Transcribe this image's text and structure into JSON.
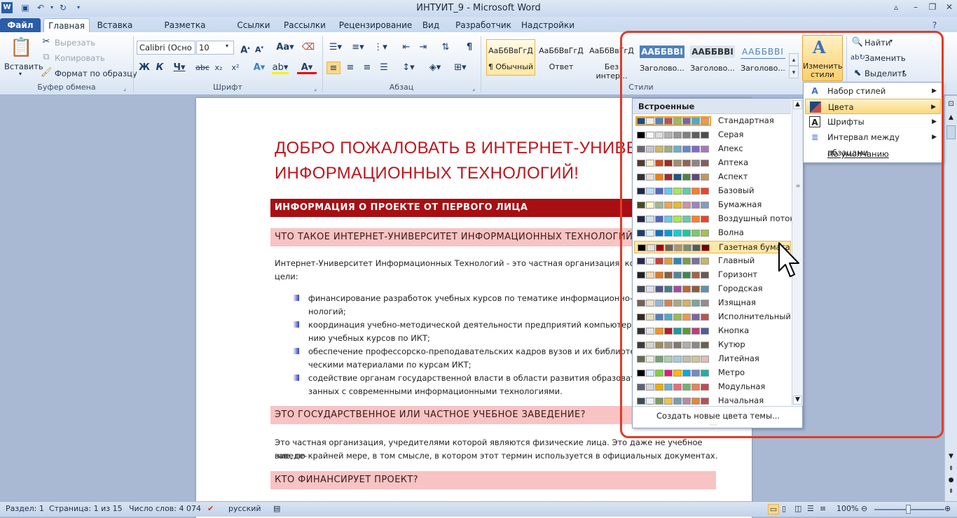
{
  "app": {
    "window_title": "ИНТУИТ_9 - Microsoft Word",
    "quick_access": [
      "word-logo-icon",
      "save-icon",
      "undo-icon",
      "redo-icon",
      "customize-icon"
    ]
  },
  "tabs": [
    {
      "label": "Файл"
    },
    {
      "label": "Главная"
    },
    {
      "label": "Вставка"
    },
    {
      "label": "Разметка страницы"
    },
    {
      "label": "Ссылки"
    },
    {
      "label": "Рассылки"
    },
    {
      "label": "Рецензирование"
    },
    {
      "label": "Вид"
    },
    {
      "label": "Разработчик"
    },
    {
      "label": "Надстройки"
    }
  ],
  "ribbon": {
    "clipboard": {
      "paste": "Вставить",
      "cut": "Вырезать",
      "copy": "Копировать",
      "format_painter": "Формат по образцу",
      "group": "Буфер обмена"
    },
    "font": {
      "name": "Calibri (Осно",
      "size": "10",
      "group": "Шрифт"
    },
    "paragraph": {
      "group": "Абзац"
    },
    "styles": {
      "items": [
        {
          "sample": "АаБбВвГгД",
          "name": "¶ Обычный"
        },
        {
          "sample": "АаБбВвГгД",
          "name": "Ответ"
        },
        {
          "sample": "АаБбВвГгД",
          "name": "Без интер..."
        },
        {
          "sample": "ААББВВІ",
          "name": "Заголово..."
        },
        {
          "sample": "ААББВВІ",
          "name": "Заголово..."
        },
        {
          "sample": "ААББВВІ",
          "name": "Заголово..."
        }
      ],
      "change_styles": "Изменить стили",
      "group": "Стили"
    },
    "editing": {
      "find": "Найти",
      "replace": "Заменить",
      "select": "Выделить"
    }
  },
  "document": {
    "title_line1": "ДОБРО ПОЖАЛОВАТЬ В ИНТЕРНЕТ-УНИВЕР",
    "title_line2": "ИНФОРМАЦИОННЫХ ТЕХНОЛОГИЙ!",
    "band1": "ИНФОРМАЦИЯ О ПРОЕКТЕ ОТ ПЕРВОГО ЛИЦА",
    "band2": "ЧТО ТАКОЕ ИНТЕРНЕТ-УНИВЕРСИТЕТ ИНФОРМАЦИОННЫХ ТЕХНОЛОГИЙ",
    "para1_l1": "Интернет-Университет Информационных Технологий - это частная организация, которая",
    "para1_l2": "цели:",
    "bullets": [
      {
        "l1": "финансирование  разработок учебных курсов по тематике информационно-комм",
        "l2": "нологий;"
      },
      {
        "l1": "координация учебно-методической деятельности предприятий компьютерной и",
        "l2": "нию учебных курсов по ИКТ;"
      },
      {
        "l1": "обеспечение профессорско-преподавательских кадров вузов и их библиотек уче",
        "l2": "ческими материалами по курсам ИКТ;"
      },
      {
        "l1": "содействие органам государственной власти в области развития образователь",
        "l2": "занных с современными информационными  технологиями."
      }
    ],
    "band3": "ЭТО ГОСУДАРСТВЕННОЕ ИЛИ ЧАСТНОЕ УЧЕБНОЕ ЗАВЕДЕНИЕ?",
    "para2_l1": "Это частная организация, учредителями которой являются физические лица. Это даже не учебное заведе-",
    "para2_l2": "ние, по крайней мере, в том смысле, в котором этот термин используется в официальных документах.",
    "band4": "КТО ФИНАНСИРУЕТ ПРОЕКТ?"
  },
  "colors_panel": {
    "header": "Встроенные",
    "create_link": "Создать новые цвета темы...",
    "themes": [
      {
        "name": "Стандартная",
        "colors": [
          "#1f497d",
          "#eeece1",
          "#4f81bd",
          "#c0504d",
          "#9bbb59",
          "#8064a2",
          "#4bacc6",
          "#f79646"
        ]
      },
      {
        "name": "Серая",
        "colors": [
          "#000000",
          "#f8f8f8",
          "#dddddd",
          "#b2b2b2",
          "#969696",
          "#808080",
          "#5f5f5f",
          "#4d4d4d"
        ]
      },
      {
        "name": "Апекс",
        "colors": [
          "#69676d",
          "#c9c2d1",
          "#ceb966",
          "#9cb084",
          "#6bb1c9",
          "#6585cf",
          "#7e6bc9",
          "#a379bb"
        ]
      },
      {
        "name": "Аптека",
        "colors": [
          "#4e3b30",
          "#fbeec9",
          "#d34817",
          "#9b2d1f",
          "#a28e6a",
          "#956251",
          "#918485",
          "#855d5d"
        ]
      },
      {
        "name": "Аспект",
        "colors": [
          "#323232",
          "#e3ded1",
          "#f07f09",
          "#9f2936",
          "#1b587c",
          "#4e8542",
          "#604878",
          "#c19859"
        ]
      },
      {
        "name": "Базовый",
        "colors": [
          "#212745",
          "#b4dcfa",
          "#4e67c8",
          "#5eccf3",
          "#a7ea52",
          "#5dceaf",
          "#ff8021",
          "#f14124"
        ]
      },
      {
        "name": "Бумажная",
        "colors": [
          "#444d26",
          "#fefac9",
          "#a5b592",
          "#f3a447",
          "#e7bc29",
          "#d092a7",
          "#9c85c0",
          "#809ec2"
        ]
      },
      {
        "name": "Воздушный поток",
        "colors": [
          "#212745",
          "#c9e2f6",
          "#4e67c8",
          "#5eccf3",
          "#a7ea52",
          "#5dceaf",
          "#ff8021",
          "#f14124"
        ]
      },
      {
        "name": "Волна",
        "colors": [
          "#17406d",
          "#dbefff",
          "#0f6fc6",
          "#009dd9",
          "#0bd0d9",
          "#10cf9b",
          "#7cca62",
          "#a5c249"
        ]
      },
      {
        "name": "Газетная бумага",
        "colors": [
          "#000000",
          "#e1e1e1",
          "#ad0101",
          "#726056",
          "#ac956e",
          "#808c6e",
          "#595959",
          "#7d0000"
        ]
      },
      {
        "name": "Главный",
        "colors": [
          "#242852",
          "#ebebeb",
          "#ce3d37",
          "#e0a130",
          "#2e87b8",
          "#7d9e44",
          "#7f6e9e",
          "#c6b85c"
        ]
      },
      {
        "name": "Горизонт",
        "colors": [
          "#1f2123",
          "#f2d8a4",
          "#e2781c",
          "#8c5d39",
          "#54849a",
          "#3e8853",
          "#a4653e",
          "#6a5b4d"
        ]
      },
      {
        "name": "Городская",
        "colors": [
          "#424456",
          "#dee0e6",
          "#53548a",
          "#438086",
          "#a04da3",
          "#c4652d",
          "#8b5d3d",
          "#5c92b5"
        ]
      },
      {
        "name": "Изящная",
        "colors": [
          "#775f55",
          "#ebddc3",
          "#94b6d2",
          "#dd8047",
          "#a5ab81",
          "#d8b25c",
          "#7ba79d",
          "#968c8c"
        ]
      },
      {
        "name": "Исполнительный",
        "colors": [
          "#2f2b20",
          "#dfdcb7",
          "#4f81bd",
          "#4bacc6",
          "#9bbb59",
          "#f79646",
          "#8064a2",
          "#c0504d"
        ]
      },
      {
        "name": "Кнопка",
        "colors": [
          "#323232",
          "#e3e3e3",
          "#f7941d",
          "#b91c2b",
          "#1f9a9a",
          "#5c9c2e",
          "#c13a85",
          "#4a5f9c"
        ]
      },
      {
        "name": "Кутюр",
        "colors": [
          "#3c3c3c",
          "#d7d2c4",
          "#9e8e5c",
          "#a09781",
          "#85776d",
          "#aeafa9",
          "#8d878b",
          "#6b6149"
        ]
      },
      {
        "name": "Литейная",
        "colors": [
          "#676a55",
          "#eaebde",
          "#72a376",
          "#b0ccb0",
          "#a8cdd7",
          "#c0beaf",
          "#cec597",
          "#e8b7b7"
        ]
      },
      {
        "name": "Метро",
        "colors": [
          "#000000",
          "#d6ecff",
          "#7fd13b",
          "#ea157a",
          "#feb80a",
          "#00addc",
          "#738ac8",
          "#1ab39f"
        ]
      },
      {
        "name": "Модульная",
        "colors": [
          "#5a6378",
          "#d4d4d6",
          "#f0ad00",
          "#60b5cc",
          "#e66c7d",
          "#6bb76d",
          "#e88651",
          "#c64847"
        ]
      },
      {
        "name": "Начальная",
        "colors": [
          "#3d4b59",
          "#e9eef2",
          "#7b9b5c",
          "#f0c341",
          "#7c9ab4",
          "#b58ba4",
          "#e18a3e",
          "#b35353"
        ]
      }
    ]
  },
  "submenu": [
    {
      "label": "Набор стилей",
      "arrow": "▶"
    },
    {
      "label": "Цвета",
      "arrow": "▶"
    },
    {
      "label": "Шрифты",
      "arrow": "▶"
    },
    {
      "label": "Интервал между абзацами",
      "arrow": "▶"
    },
    {
      "label": "По умолчанию",
      "arrow": ""
    }
  ],
  "status": {
    "section": "Раздел: 1",
    "page": "Страница: 1 из 15",
    "words": "Число слов: 4 074",
    "language": "русский",
    "zoom": "100%"
  }
}
